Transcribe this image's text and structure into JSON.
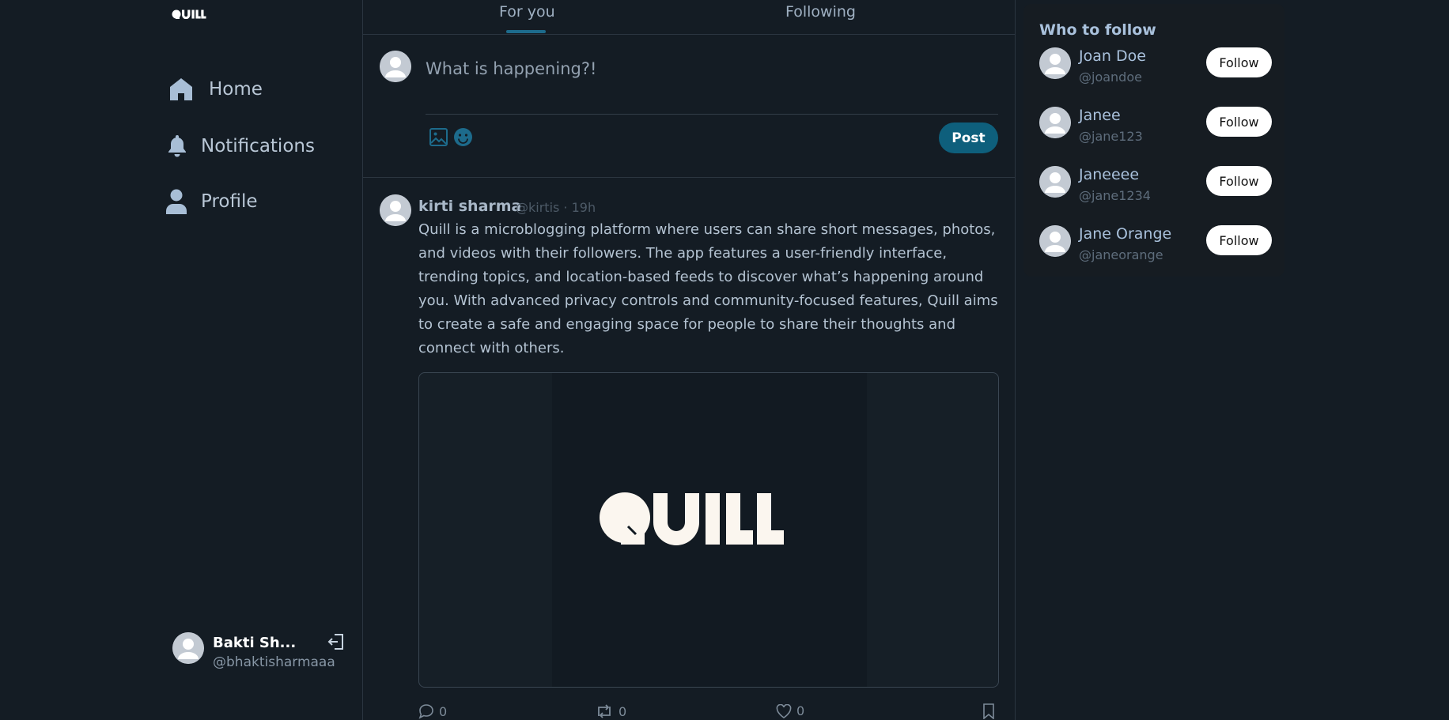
{
  "app": {
    "logo_text": "QUILL",
    "brand_text": "QUILL"
  },
  "sidebar": {
    "items": [
      {
        "label": "Home",
        "icon": "home-icon"
      },
      {
        "label": "Notifications",
        "icon": "bell-icon"
      },
      {
        "label": "Profile",
        "icon": "user-icon"
      }
    ],
    "user": {
      "name": "Bakti Sh...",
      "handle": "@bhaktisharmaaa"
    }
  },
  "tabs": [
    {
      "label": "For you",
      "active": true
    },
    {
      "label": "Following",
      "active": false
    }
  ],
  "composer": {
    "placeholder": "What is happening?!",
    "post_label": "Post"
  },
  "post": {
    "author": "kirti sharma",
    "meta": "@kirtis · 19h",
    "text": "Quill is a microblogging platform where users can share short messages, photos, and videos with their followers. The app features a user-friendly interface, trending topics, and location-based feeds to discover what’s happening around you. With advanced privacy controls and community-focused features, Quill aims to create a safe and engaging space for people to share their thoughts and connect with others.",
    "comments": "0",
    "reposts": "0",
    "likes": "0"
  },
  "who_to_follow": {
    "title": "Who to follow",
    "button_label": "Follow",
    "users": [
      {
        "name": "Joan Doe",
        "handle": "@joandoe"
      },
      {
        "name": "Janee",
        "handle": "@jane123"
      },
      {
        "name": "Janeeee",
        "handle": "@jane1234"
      },
      {
        "name": "Jane Orange",
        "handle": "@janeorange"
      }
    ]
  },
  "colors": {
    "background": "#141c24",
    "accent": "#0e5f7c",
    "follow_button": "#ffffff"
  }
}
